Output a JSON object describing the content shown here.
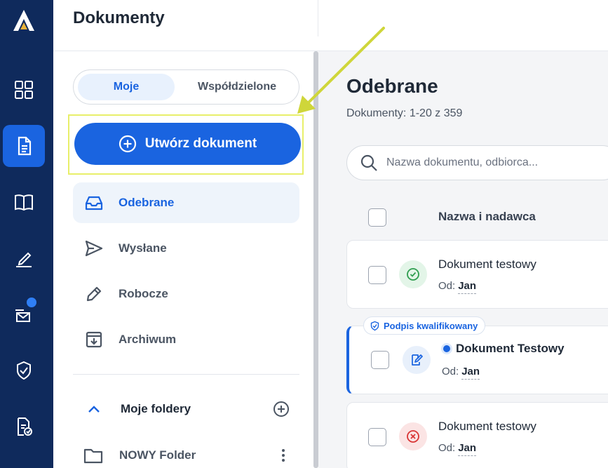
{
  "header": {
    "title": "Dokumenty"
  },
  "rail": {
    "items": [
      "dashboard",
      "documents",
      "library",
      "signature",
      "inbox-ai",
      "certificate",
      "document-check"
    ]
  },
  "sidebar": {
    "tabs": {
      "mine": "Moje",
      "shared": "Współdzielone"
    },
    "create_label": "Utwórz dokument",
    "nav": [
      {
        "label": "Odebrane",
        "icon": "inbox-icon"
      },
      {
        "label": "Wysłane",
        "icon": "send-icon"
      },
      {
        "label": "Robocze",
        "icon": "pencil-icon"
      },
      {
        "label": "Archiwum",
        "icon": "archive-icon"
      }
    ],
    "folders_title": "Moje foldery",
    "folder": "NOWY Folder"
  },
  "main": {
    "title": "Odebrane",
    "count": "Dokumenty: 1-20 z 359",
    "search_placeholder": "Nazwa dokumentu, odbiorca...",
    "column_name": "Nazwa i nadawca",
    "badge": "Podpis kwalifikowany",
    "from_label": "Od:",
    "docs": [
      {
        "name": "Dokument testowy",
        "sender": "Jan",
        "status": "signed"
      },
      {
        "name": "Dokument Testowy",
        "sender": "Jan",
        "status": "to-sign"
      },
      {
        "name": "Dokument testowy",
        "sender": "Jan",
        "status": "rejected"
      }
    ]
  },
  "colors": {
    "rail_bg": "#0f2a5c",
    "accent": "#1a64e0",
    "success": "#2e9e4f",
    "danger": "#d93636",
    "annotation": "#cfd63a"
  }
}
